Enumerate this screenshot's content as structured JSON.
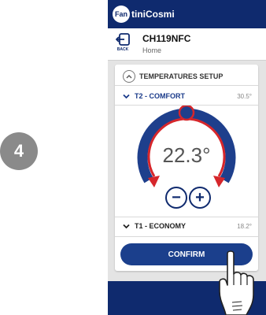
{
  "step": {
    "number": "4"
  },
  "app": {
    "brand": "FantiniCosmi",
    "brand_prefix": "Fan",
    "brand_rest": "tiniCosmi"
  },
  "header": {
    "back_label": "BACK",
    "device_name": "CH119NFC",
    "subtitle": "Home"
  },
  "temperatures": {
    "section_title": "TEMPERATURES SETUP",
    "rows": [
      {
        "label": "T2 - COMFORT",
        "value": "30.5°"
      },
      {
        "label": "T1 - ECONOMY",
        "value": "18.2°"
      }
    ],
    "current_setpoint": "22.3°",
    "minus_label": "−",
    "plus_label": "+"
  },
  "actions": {
    "confirm_label": "CONFIRM"
  },
  "colors": {
    "primary": "#0f2a6e",
    "accent_red": "#d6262b",
    "button": "#1b3f8c"
  },
  "icons": [
    "back-icon",
    "chevron-up-icon",
    "chevron-down-icon",
    "minus-icon",
    "plus-icon",
    "hand-pointer-icon"
  ]
}
